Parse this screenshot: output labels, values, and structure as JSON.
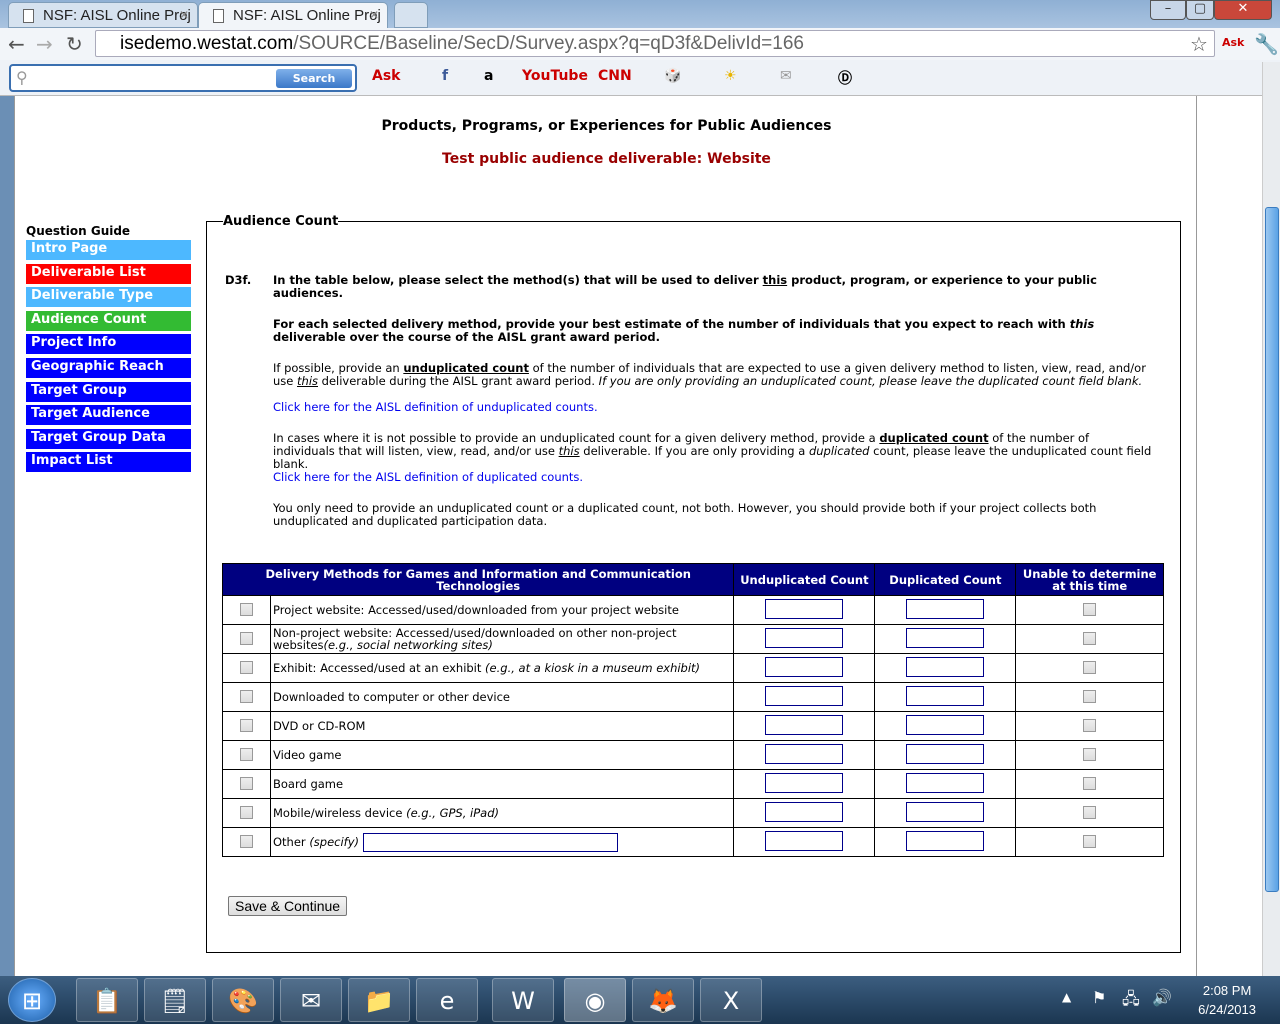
{
  "browser": {
    "tabs": [
      {
        "title": "NSF: AISL Online Proj"
      },
      {
        "title": "NSF: AISL Online Proj"
      }
    ],
    "url_host": "isedemo.westat.com",
    "url_path": "/SOURCE/Baseline/SecD/Survey.aspx?q=qD3f&DelivId=166"
  },
  "toolbar": {
    "search_button": "Search",
    "search_placeholder": ""
  },
  "page": {
    "title": "Products, Programs, or Experiences for Public Audiences",
    "subtitle": "Test public audience deliverable: Website"
  },
  "guide": {
    "title": "Question Guide",
    "items": [
      {
        "label": "Intro Page",
        "color": "#4db8ff"
      },
      {
        "label": "Deliverable List",
        "color": "#ff0000"
      },
      {
        "label": "Deliverable Type",
        "color": "#4db8ff"
      },
      {
        "label": "Audience Count",
        "color": "#33bb33"
      },
      {
        "label": "Project Info",
        "color": "#0000ff"
      },
      {
        "label": "Geographic Reach",
        "color": "#0000ff"
      },
      {
        "label": "Target Group",
        "color": "#0000ff"
      },
      {
        "label": "Target Audience",
        "color": "#0000ff"
      },
      {
        "label": "Target Group Data",
        "color": "#0000ff"
      },
      {
        "label": "Impact List",
        "color": "#0000ff"
      }
    ]
  },
  "section": {
    "legend": "Audience Count",
    "qnum": "D3f.",
    "p1a": "In the table below, please select the method(s) that will be used to deliver ",
    "p1b": "this",
    "p1c": " product, program, or experience to your public audiences.",
    "p2a": "For each selected delivery method, provide your best estimate of the number of individuals that you expect to reach with ",
    "p2b": "this",
    "p2c": " deliverable over the course of the AISL grant award period.",
    "p3a": "If possible, provide an ",
    "p3b": "unduplicated count",
    "p3c": " of the number of individuals that are expected to use a given delivery method to listen, view, read, and/or use ",
    "p3d": "this",
    "p3e": " deliverable during the AISL grant award period. ",
    "p3f": "If you are only providing an unduplicated count, please leave the duplicated count field blank.",
    "link1": "Click here for the AISL definition of unduplicated counts.",
    "p4a": "In cases where it is not possible to provide an unduplicated count for a given delivery method, provide a ",
    "p4b": "duplicated count",
    "p4c": " of the number of individuals that will listen, view, read, and/or use ",
    "p4d": "this",
    "p4e": " deliverable. If you are only providing a ",
    "p4f": "duplicated",
    "p4g": " count, please leave the unduplicated count field blank.",
    "link2": "Click here for the AISL definition of duplicated counts.",
    "p5": "You only need to provide an unduplicated count or a duplicated count, not both. However, you should provide both if your project collects both unduplicated and duplicated participation data."
  },
  "table": {
    "headers": [
      "Delivery Methods for Games and Information and Communication Technologies",
      "Unduplicated Count",
      "Duplicated Count",
      "Unable to determine at this time"
    ],
    "rows": [
      {
        "label": "Project website: Accessed/used/downloaded from your project website",
        "note": ""
      },
      {
        "label": "Non-project website: Accessed/used/downloaded on other non-project websites",
        "note": "(e.g., social networking sites)"
      },
      {
        "label": "Exhibit: Accessed/used at an exhibit ",
        "note": "(e.g., at a kiosk in a museum exhibit)"
      },
      {
        "label": "Downloaded to computer or other device",
        "note": ""
      },
      {
        "label": "DVD or CD-ROM",
        "note": ""
      },
      {
        "label": "Video game",
        "note": ""
      },
      {
        "label": "Board game",
        "note": ""
      },
      {
        "label": "Mobile/wireless device ",
        "note": "(e.g., GPS, iPad)"
      },
      {
        "label": "Other ",
        "note": "(specify)"
      }
    ]
  },
  "save_button": "Save & Continue",
  "taskbar": {
    "time": "2:08 PM",
    "date": "6/24/2013"
  }
}
